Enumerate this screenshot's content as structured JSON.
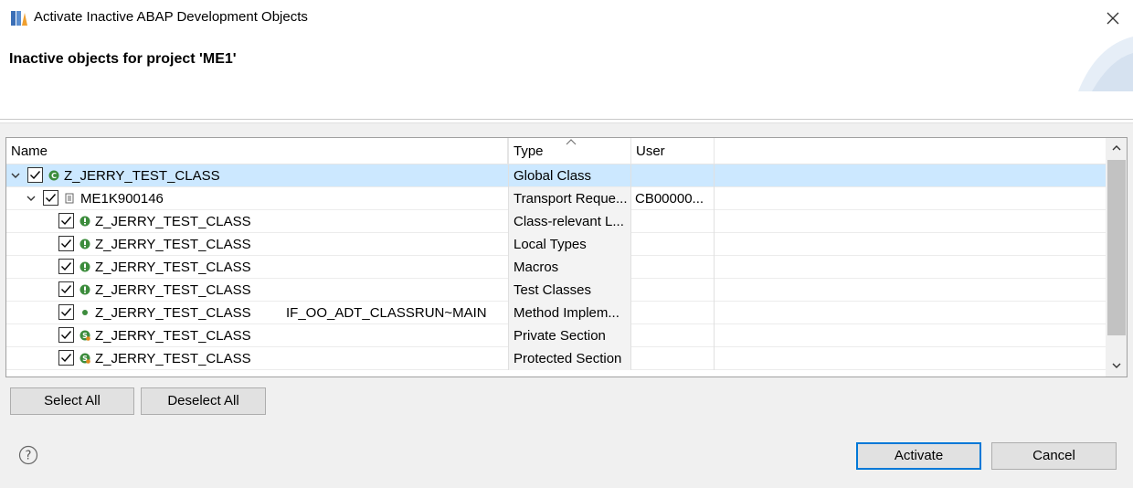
{
  "window": {
    "title": "Activate Inactive ABAP Development Objects"
  },
  "header": {
    "title": "Inactive objects for project 'ME1'"
  },
  "table": {
    "columns": {
      "name": "Name",
      "type": "Type",
      "user": "User"
    },
    "rows": [
      {
        "name": "Z_JERRY_TEST_CLASS",
        "extra": "",
        "type": "Global Class",
        "user": "",
        "checked": true,
        "icon": "global-class-icon"
      },
      {
        "name": "ME1K900146",
        "extra": "",
        "type": "Transport Reque...",
        "user": "CB00000...",
        "checked": true,
        "icon": "transport-request-icon"
      },
      {
        "name": "Z_JERRY_TEST_CLASS",
        "extra": "",
        "type": "Class-relevant L...",
        "user": "",
        "checked": true,
        "icon": "include-icon"
      },
      {
        "name": "Z_JERRY_TEST_CLASS",
        "extra": "",
        "type": "Local Types",
        "user": "",
        "checked": true,
        "icon": "include-icon"
      },
      {
        "name": "Z_JERRY_TEST_CLASS",
        "extra": "",
        "type": "Macros",
        "user": "",
        "checked": true,
        "icon": "include-icon"
      },
      {
        "name": "Z_JERRY_TEST_CLASS",
        "extra": "",
        "type": "Test Classes",
        "user": "",
        "checked": true,
        "icon": "include-icon"
      },
      {
        "name": "Z_JERRY_TEST_CLASS",
        "extra": "IF_OO_ADT_CLASSRUN~MAIN",
        "type": "Method Implem...",
        "user": "",
        "checked": true,
        "icon": "method-icon"
      },
      {
        "name": "Z_JERRY_TEST_CLASS",
        "extra": "",
        "type": "Private Section",
        "user": "",
        "checked": true,
        "icon": "section-icon"
      },
      {
        "name": "Z_JERRY_TEST_CLASS",
        "extra": "",
        "type": "Protected Section",
        "user": "",
        "checked": true,
        "icon": "section-icon"
      }
    ]
  },
  "buttons": {
    "select_all": "Select All",
    "deselect_all": "Deselect All",
    "activate": "Activate",
    "cancel": "Cancel"
  },
  "colors": {
    "selection": "#cce8ff",
    "accent": "#0078d7",
    "icon_green": "#3c8c3c"
  }
}
